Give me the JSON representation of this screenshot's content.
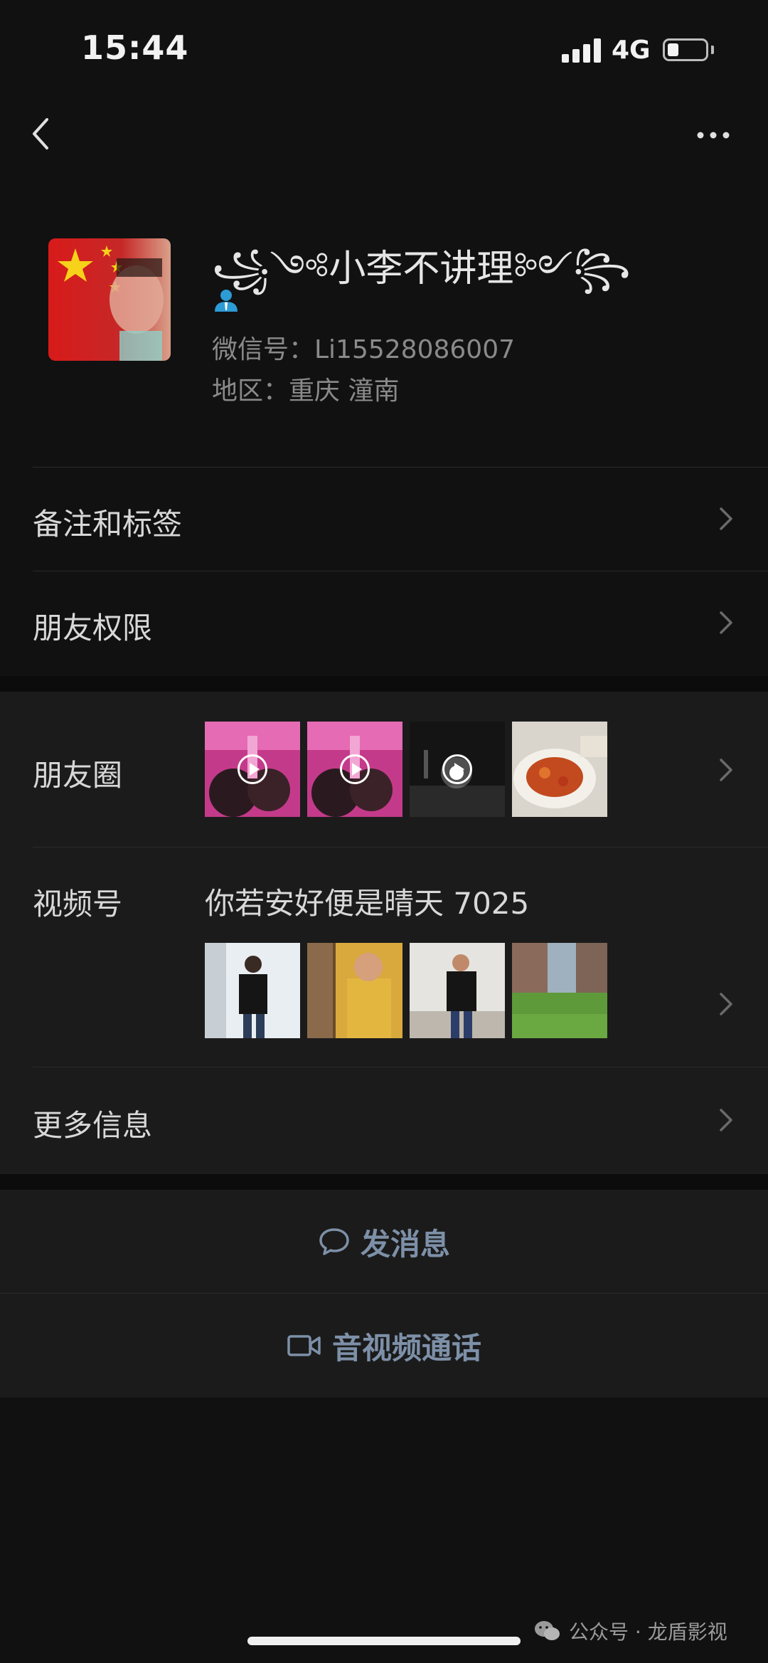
{
  "status_bar": {
    "time": "15:44",
    "network": "4G",
    "battery_level": 0.3
  },
  "profile": {
    "nickname": "꧁༺小李不讲理༻꧂",
    "wechat_id": "微信号：Li15528086007",
    "region": "地区：重庆 潼南"
  },
  "menu": {
    "remarks_tags": "备注和标签",
    "friend_permissions": "朋友权限",
    "moments": "朋友圈",
    "channels": "视频号",
    "channel_name": "你若安好便是晴天 7025",
    "more_info": "更多信息"
  },
  "actions": {
    "send_message": "发消息",
    "video_call": "音视频通话"
  },
  "footer": {
    "watermark": "公众号 · 龙盾影视"
  },
  "colors": {
    "background": "#111111",
    "section": "#1b1b1b",
    "action_text": "#7d90a8"
  }
}
